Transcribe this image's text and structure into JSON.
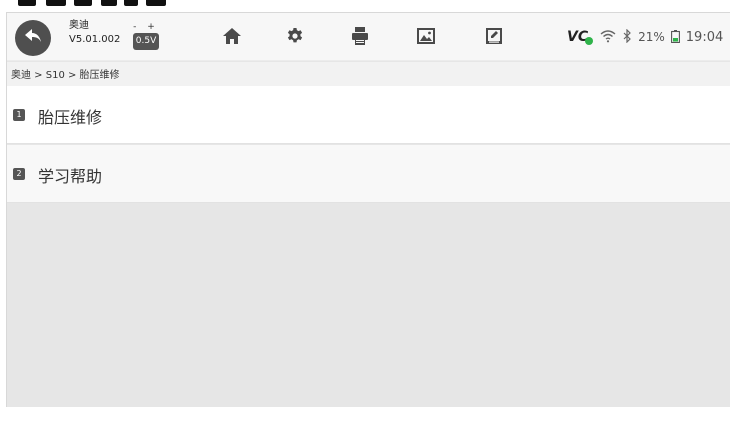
{
  "toolbar": {
    "app_name": "奥迪",
    "app_version": "V5.01.002",
    "battery_signs": "- +",
    "battery_voltage": "0.5V"
  },
  "status": {
    "vci_label": "VC",
    "battery_percent": "21%",
    "time": "19:04"
  },
  "breadcrumb": "奥迪 > S10 > 胎压维修",
  "menu": {
    "items": [
      {
        "index": "1",
        "label": "胎压维修"
      },
      {
        "index": "2",
        "label": "学习帮助"
      }
    ]
  },
  "colors": {
    "vci_indicator": "#2fb34a",
    "icon_dark": "#555555",
    "content_background": "#e6e6e6"
  },
  "icons": {
    "back": "back-arrow-icon",
    "home": "home-icon",
    "settings": "gear-icon",
    "print": "printer-icon",
    "gallery": "image-icon",
    "feedback": "edit-icon",
    "wifi": "wifi-icon",
    "bluetooth": "bluetooth-icon",
    "battery": "battery-icon"
  }
}
